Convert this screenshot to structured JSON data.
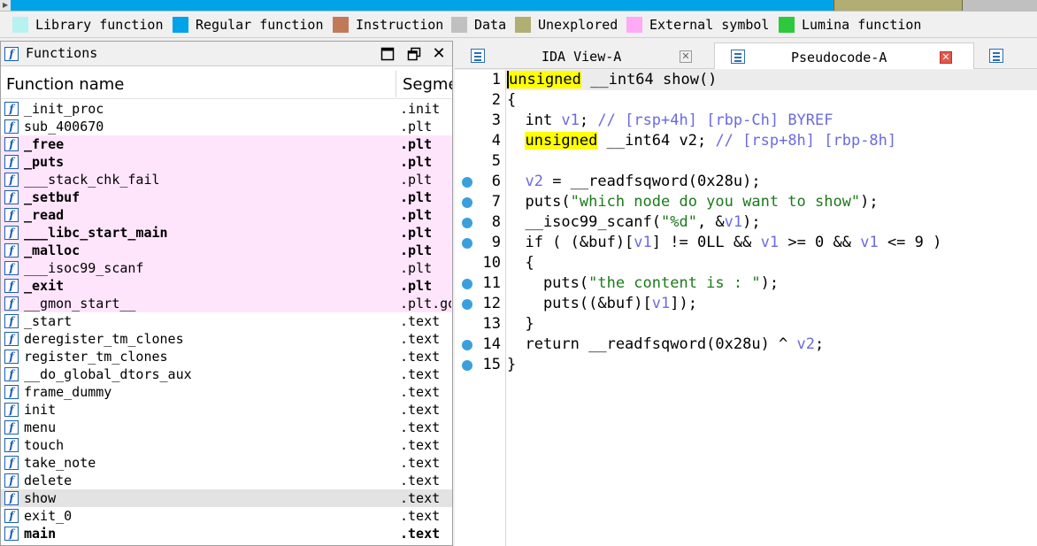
{
  "legend": [
    {
      "label": "Library function",
      "color": "#b6f2f2"
    },
    {
      "label": "Regular function",
      "color": "#00a2e8"
    },
    {
      "label": "Instruction",
      "color": "#c07a5a"
    },
    {
      "label": "Data",
      "color": "#c0c0c0"
    },
    {
      "label": "Unexplored",
      "color": "#b0ae72"
    },
    {
      "label": "External symbol",
      "color": "#ffaaf5"
    },
    {
      "label": "Lumina function",
      "color": "#2ec83c"
    }
  ],
  "functions_panel": {
    "title": "Functions",
    "header_name": "Function name",
    "header_segment": "Segment",
    "rows": [
      {
        "name": "_init_proc",
        "segment": ".init",
        "style": "normal"
      },
      {
        "name": "sub_400670",
        "segment": ".plt",
        "style": "normal"
      },
      {
        "name": "_free",
        "segment": ".plt",
        "style": "external-bold"
      },
      {
        "name": "_puts",
        "segment": ".plt",
        "style": "external-bold"
      },
      {
        "name": "___stack_chk_fail",
        "segment": ".plt",
        "style": "external"
      },
      {
        "name": "_setbuf",
        "segment": ".plt",
        "style": "external-bold"
      },
      {
        "name": "_read",
        "segment": ".plt",
        "style": "external-bold"
      },
      {
        "name": "___libc_start_main",
        "segment": ".plt",
        "style": "external-bold"
      },
      {
        "name": "_malloc",
        "segment": ".plt",
        "style": "external-bold"
      },
      {
        "name": "___isoc99_scanf",
        "segment": ".plt",
        "style": "external"
      },
      {
        "name": "_exit",
        "segment": ".plt",
        "style": "external-bold"
      },
      {
        "name": "__gmon_start__",
        "segment": ".plt.got",
        "style": "external"
      },
      {
        "name": "_start",
        "segment": ".text",
        "style": "normal"
      },
      {
        "name": "deregister_tm_clones",
        "segment": ".text",
        "style": "normal"
      },
      {
        "name": "register_tm_clones",
        "segment": ".text",
        "style": "normal"
      },
      {
        "name": "__do_global_dtors_aux",
        "segment": ".text",
        "style": "normal"
      },
      {
        "name": "frame_dummy",
        "segment": ".text",
        "style": "normal"
      },
      {
        "name": "init",
        "segment": ".text",
        "style": "normal"
      },
      {
        "name": "menu",
        "segment": ".text",
        "style": "normal"
      },
      {
        "name": "touch",
        "segment": ".text",
        "style": "normal"
      },
      {
        "name": "take_note",
        "segment": ".text",
        "style": "normal"
      },
      {
        "name": "delete",
        "segment": ".text",
        "style": "normal"
      },
      {
        "name": "show",
        "segment": ".text",
        "style": "selected"
      },
      {
        "name": "exit_0",
        "segment": ".text",
        "style": "normal"
      },
      {
        "name": "main",
        "segment": ".text",
        "style": "bold"
      }
    ]
  },
  "tabs": [
    {
      "label": "IDA View-A",
      "active": false
    },
    {
      "label": "Pseudocode-A",
      "active": true
    }
  ],
  "code_lines": [
    {
      "n": "1",
      "bp": false,
      "tokens": [
        {
          "t": "unsigned",
          "c": "kw-hl cursor"
        },
        {
          "t": " __int64 show()",
          "c": "c-kw"
        }
      ]
    },
    {
      "n": "2",
      "bp": false,
      "tokens": [
        {
          "t": "{",
          "c": "c-kw"
        }
      ]
    },
    {
      "n": "3",
      "bp": false,
      "tokens": [
        {
          "t": "  int ",
          "c": "c-kw"
        },
        {
          "t": "v1",
          "c": "c-var"
        },
        {
          "t": "; ",
          "c": "c-kw"
        },
        {
          "t": "// [rsp+4h] [rbp-Ch] BYREF",
          "c": "c-com"
        }
      ]
    },
    {
      "n": "4",
      "bp": false,
      "tokens": [
        {
          "t": "  ",
          "c": "c-kw"
        },
        {
          "t": "unsigned",
          "c": "kw-hl"
        },
        {
          "t": " __int64 v2; ",
          "c": "c-kw"
        },
        {
          "t": "// [rsp+8h] [rbp-8h]",
          "c": "c-com"
        }
      ]
    },
    {
      "n": "5",
      "bp": false,
      "tokens": []
    },
    {
      "n": "6",
      "bp": true,
      "tokens": [
        {
          "t": "  ",
          "c": "c-kw"
        },
        {
          "t": "v2",
          "c": "c-var"
        },
        {
          "t": " = __readfsqword(0x28u);",
          "c": "c-kw"
        }
      ]
    },
    {
      "n": "7",
      "bp": true,
      "tokens": [
        {
          "t": "  puts(",
          "c": "c-kw"
        },
        {
          "t": "\"which node do you want to show\"",
          "c": "c-str"
        },
        {
          "t": ");",
          "c": "c-kw"
        }
      ]
    },
    {
      "n": "8",
      "bp": true,
      "tokens": [
        {
          "t": "  __isoc99_scanf(",
          "c": "c-kw"
        },
        {
          "t": "\"%d\"",
          "c": "c-str"
        },
        {
          "t": ", &",
          "c": "c-kw"
        },
        {
          "t": "v1",
          "c": "c-var"
        },
        {
          "t": ");",
          "c": "c-kw"
        }
      ]
    },
    {
      "n": "9",
      "bp": true,
      "tokens": [
        {
          "t": "  if ( (&buf)[",
          "c": "c-kw"
        },
        {
          "t": "v1",
          "c": "c-var"
        },
        {
          "t": "] != 0LL && ",
          "c": "c-kw"
        },
        {
          "t": "v1",
          "c": "c-var"
        },
        {
          "t": " >= 0 && ",
          "c": "c-kw"
        },
        {
          "t": "v1",
          "c": "c-var"
        },
        {
          "t": " <= 9 )",
          "c": "c-kw"
        }
      ]
    },
    {
      "n": "10",
      "bp": false,
      "tokens": [
        {
          "t": "  {",
          "c": "c-kw"
        }
      ]
    },
    {
      "n": "11",
      "bp": true,
      "tokens": [
        {
          "t": "    puts(",
          "c": "c-kw"
        },
        {
          "t": "\"the content is : \"",
          "c": "c-str"
        },
        {
          "t": ");",
          "c": "c-kw"
        }
      ]
    },
    {
      "n": "12",
      "bp": true,
      "tokens": [
        {
          "t": "    puts((&buf)[",
          "c": "c-kw"
        },
        {
          "t": "v1",
          "c": "c-var"
        },
        {
          "t": "]);",
          "c": "c-kw"
        }
      ]
    },
    {
      "n": "13",
      "bp": false,
      "tokens": [
        {
          "t": "  }",
          "c": "c-kw"
        }
      ]
    },
    {
      "n": "14",
      "bp": true,
      "tokens": [
        {
          "t": "  return __readfsqword(0x28u) ^ ",
          "c": "c-kw"
        },
        {
          "t": "v2",
          "c": "c-var"
        },
        {
          "t": ";",
          "c": "c-kw"
        }
      ]
    },
    {
      "n": "15",
      "bp": true,
      "tokens": [
        {
          "t": "}",
          "c": "c-kw"
        }
      ]
    }
  ]
}
